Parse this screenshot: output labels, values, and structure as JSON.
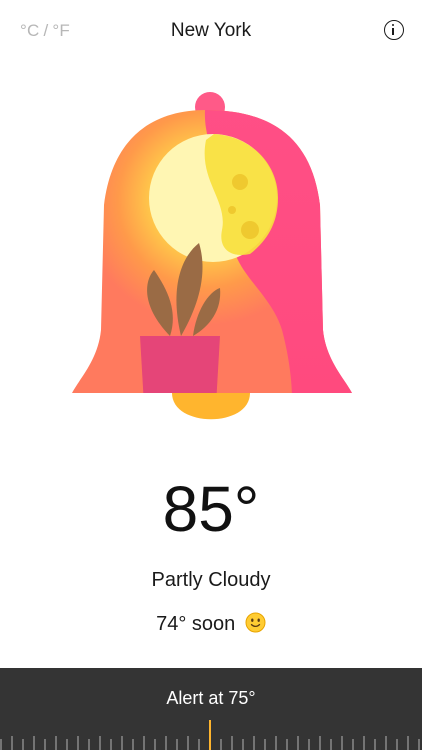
{
  "header": {
    "unit_celsius": "°C",
    "unit_separator": "/",
    "unit_fahrenheit": "°F",
    "city": "New York",
    "info_icon": "info-icon"
  },
  "weather": {
    "temperature": "85°",
    "condition": "Partly Cloudy",
    "forecast_text": "74° soon",
    "forecast_emoji": "slightly-smiling-face"
  },
  "alert": {
    "label": "Alert at 75°"
  },
  "colors": {
    "bell_left": "#ff7b5e",
    "bell_right": "#ff4f86",
    "sun_core": "#fff6b3",
    "moon": "#f9df3e",
    "plant_leaf": "#9a6b45",
    "pot": "#e54578",
    "clapper": "#ffb52e",
    "alert_bar": "#343434",
    "ruler_tick": "#8a8a8a",
    "ruler_active": "#ffb52e"
  }
}
